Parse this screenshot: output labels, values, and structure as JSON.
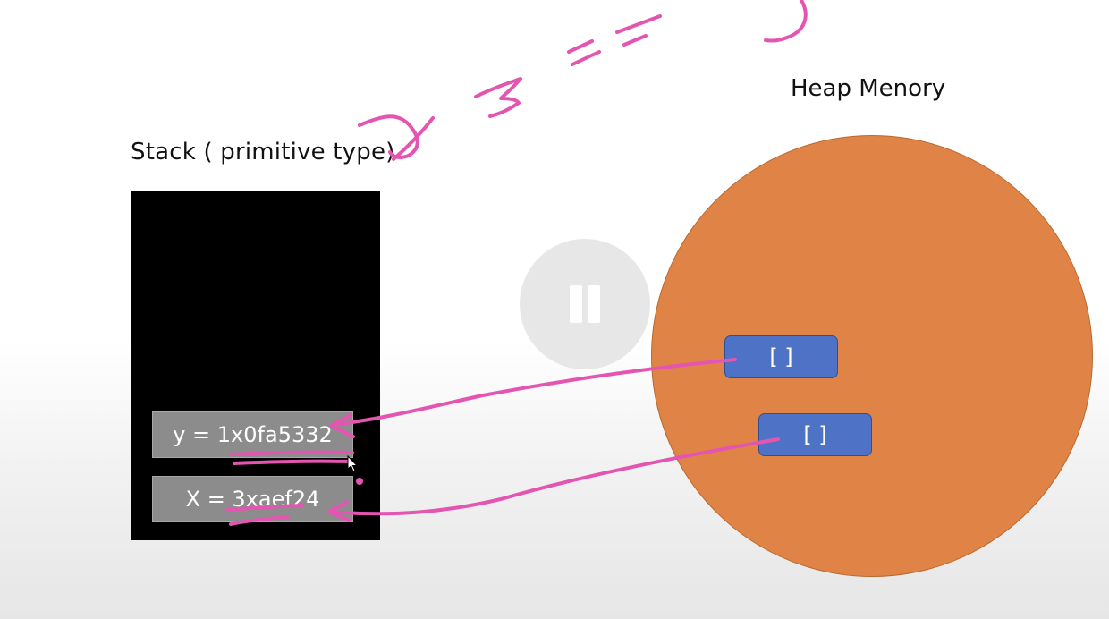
{
  "stack": {
    "title": "Stack ( primitive type)",
    "cells": [
      {
        "text": "y = 1x0fa5332"
      },
      {
        "text": "X = 3xaef24"
      }
    ]
  },
  "heap": {
    "title": "Heap Menory",
    "objects": [
      {
        "text": "[ ]"
      },
      {
        "text": "[ ]"
      }
    ]
  },
  "colors": {
    "stack_bg": "#000000",
    "cell_bg": "#8c8c8c",
    "heap_fill": "#df8446",
    "object_fill": "#4e73c6",
    "annotation_ink": "#e455b2"
  },
  "controls": {
    "pause_icon": "pause-icon"
  }
}
